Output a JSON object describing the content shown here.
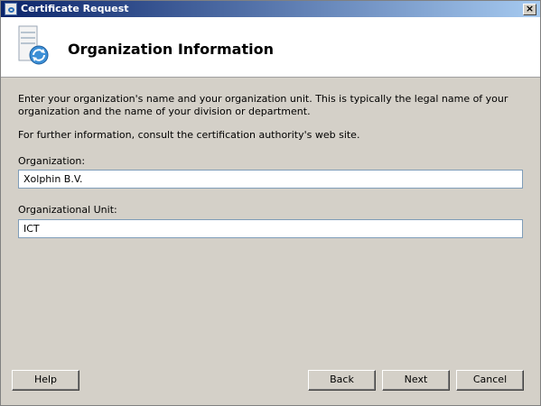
{
  "window": {
    "title": "Certificate Request",
    "close_glyph": "×"
  },
  "header": {
    "title": "Organization Information",
    "icon": "certificate-server-icon"
  },
  "content": {
    "description": "Enter your organization's name and your organization unit. This is typically the legal name of your organization and the name of your division or department.",
    "further_info": "For further information, consult the certification authority's web site.",
    "organization": {
      "label": "Organization:",
      "value": "Xolphin B.V."
    },
    "organizational_unit": {
      "label": "Organizational Unit:",
      "value": "ICT"
    }
  },
  "buttons": {
    "help": "Help",
    "back": "Back",
    "next": "Next",
    "cancel": "Cancel"
  },
  "colors": {
    "titlebar_start": "#0a246a",
    "titlebar_end": "#a6caf0",
    "dialog_bg": "#d4d0c8",
    "header_bg": "#ffffff"
  }
}
